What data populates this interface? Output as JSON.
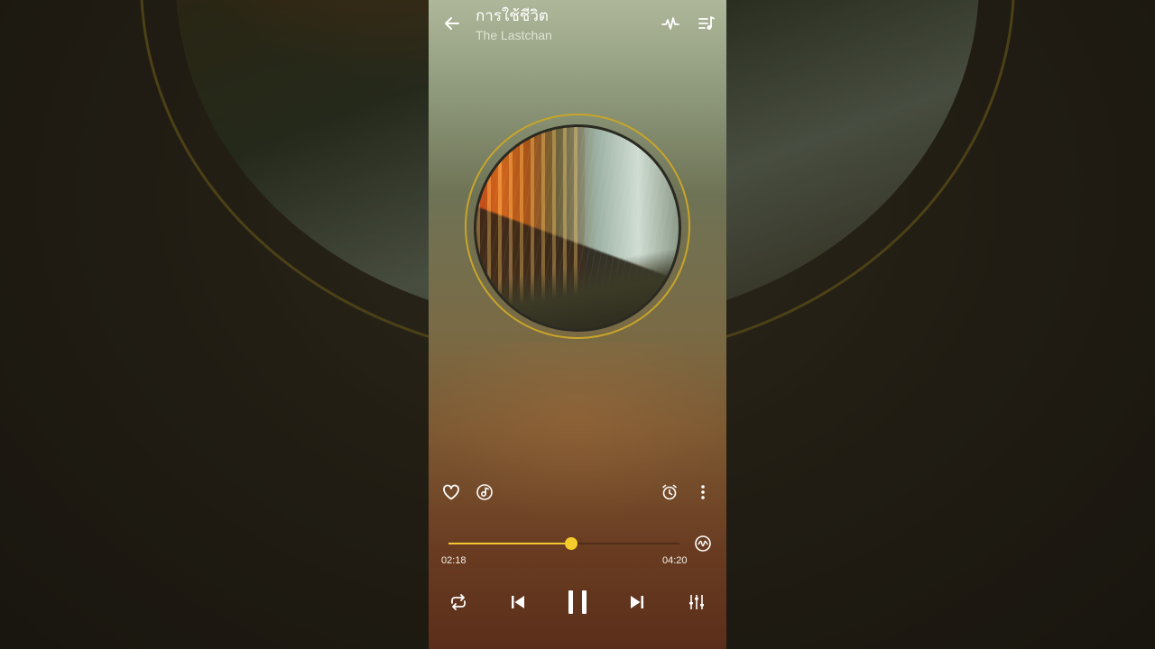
{
  "track": {
    "title": "การใช้ชีวิต",
    "artist": "The Lastchan"
  },
  "header": {
    "back_icon": "back-arrow-icon",
    "waveform_icon": "audio-wave-icon",
    "queue_icon": "playlist-queue-icon"
  },
  "actions": {
    "favorite_icon": "heart-icon",
    "disc_icon": "disc-music-icon",
    "alarm_icon": "alarm-clock-icon",
    "more_icon": "more-vertical-icon"
  },
  "playback": {
    "current_time": "02:18",
    "total_time": "04:20",
    "progress": 0.53
  },
  "controls": {
    "repeat_icon": "repeat-icon",
    "previous_icon": "skip-previous-icon",
    "pause_icon": "pause-icon",
    "next_icon": "skip-next-icon",
    "equalizer_icon": "equalizer-icon",
    "sleep_wave_icon": "sound-wave-circle-icon"
  },
  "colors": {
    "accent": "#f2c830",
    "ring": "#c8a52a"
  }
}
